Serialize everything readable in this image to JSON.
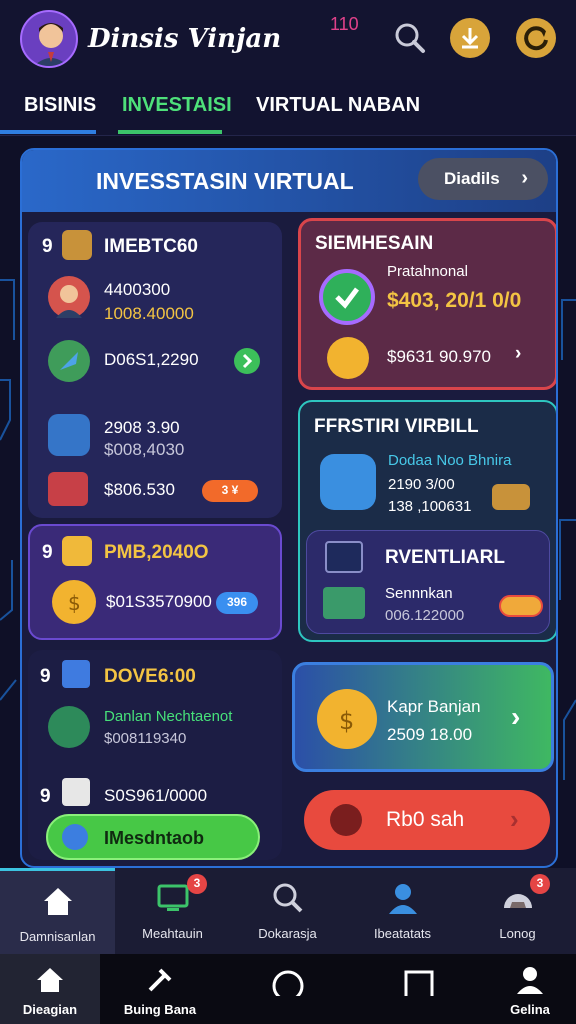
{
  "header": {
    "app_title": "Dinsis Vinjan",
    "notification_count": "110"
  },
  "tabs": [
    {
      "label": "BISINIS"
    },
    {
      "label": "INVESTAISI"
    },
    {
      "label": "VIRTUAL  NABAN"
    }
  ],
  "panel": {
    "title": "INVESSTASIN VIRTUAL",
    "details_label": "Diadils"
  },
  "left": {
    "card1": {
      "heading_num": "9",
      "heading": "IMEBTC60",
      "row1_value": "4400300",
      "row1_sub": "1008.40000",
      "row2_value": "D06S1,2290",
      "row3_value": "2908 3.90",
      "row3_sub": "$008,4030",
      "row4_value": "$806.530",
      "row4_pill": "3 ¥"
    },
    "card2": {
      "heading_num": "9",
      "heading": "PMB,2040O",
      "value": "$01S3570900",
      "pill": "396"
    },
    "card3": {
      "heading_num": "9",
      "heading": "DOVE6:00",
      "row1_title": "Danlan Nechtaenot",
      "row1_sub": "$008119340",
      "row2_num": "9",
      "row2_value": "S0S961/0000",
      "button_label": "IMesdntaob"
    }
  },
  "right": {
    "card1": {
      "heading": "SIEMHESAIN",
      "label": "Pratahnonal",
      "value": "$403, 20/1 0/0",
      "row2_value": "$9631 90.970"
    },
    "card2": {
      "heading": "FFRSTIRI VIRBILL",
      "row_title": "Dodaa Noo Bhnira",
      "row_val1": "2190 3/00",
      "row_val2": "138 ,100631"
    },
    "card2_inner": {
      "heading": "RVENTLIARL",
      "label": "Sennnkan",
      "value": "006.122000"
    },
    "card3": {
      "label": "Kapr Banjan",
      "value": "2509 18.00"
    },
    "card4": {
      "label": "Rb0 sah"
    }
  },
  "app_nav": [
    {
      "label": "Damnisanlan",
      "icon": "home-icon"
    },
    {
      "label": "Meahtauin",
      "icon": "monitor-icon",
      "badge": "3"
    },
    {
      "label": "Dokarasja",
      "icon": "search-icon"
    },
    {
      "label": "Ibeatatats",
      "icon": "gear-person-icon"
    },
    {
      "label": "Lonog",
      "icon": "gauge-icon",
      "badge": "3"
    }
  ],
  "system_nav": [
    {
      "label": "Dieagian",
      "icon": "home-icon"
    },
    {
      "label": "Buing Bana",
      "icon": "tools-icon"
    },
    {
      "label": "",
      "icon": "circle-home-icon"
    },
    {
      "label": "",
      "icon": "square-recents-icon"
    },
    {
      "label": "Gelina",
      "icon": "person-icon"
    }
  ],
  "colors": {
    "accent_green": "#47e07a",
    "accent_blue": "#2f7ee0",
    "gold": "#f3c443",
    "danger": "#e84a3e"
  }
}
